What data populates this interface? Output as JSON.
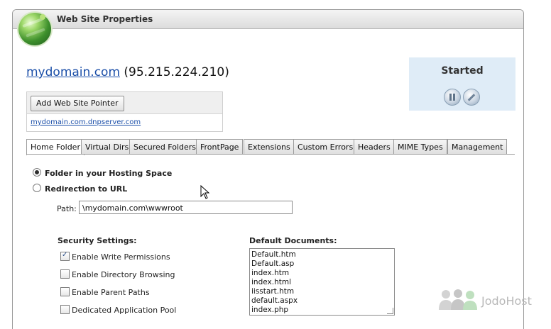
{
  "panel": {
    "title": "Web Site Properties"
  },
  "site": {
    "domain": "mydomain.com",
    "ip": "(95.215.224.210)",
    "add_pointer_label": "Add Web Site Pointer",
    "pointer_link": "mydomain.com.dnpserver.com"
  },
  "status": {
    "label": "Started",
    "controls": [
      "pause-icon",
      "stop-icon"
    ]
  },
  "tabs": [
    {
      "label": "Home Folder",
      "active": true
    },
    {
      "label": "Virtual Dirs"
    },
    {
      "label": "Secured Folders"
    },
    {
      "label": "FrontPage"
    },
    {
      "label": "Extensions"
    },
    {
      "label": "Custom Errors"
    },
    {
      "label": "Headers"
    },
    {
      "label": "MIME Types"
    },
    {
      "label": "Management"
    }
  ],
  "home_folder": {
    "options": [
      {
        "label": "Folder in your Hosting Space",
        "checked": true
      },
      {
        "label": "Redirection to URL",
        "checked": false
      }
    ],
    "path_label": "Path:",
    "path_value": "\\mydomain.com\\wwwroot"
  },
  "security": {
    "title": "Security Settings:",
    "items": [
      {
        "label": "Enable Write Permissions",
        "checked": true
      },
      {
        "label": "Enable Directory Browsing",
        "checked": false
      },
      {
        "label": "Enable Parent Paths",
        "checked": false
      },
      {
        "label": "Dedicated Application Pool",
        "checked": false
      }
    ]
  },
  "default_documents": {
    "title": "Default Documents:",
    "items": [
      "Default.htm",
      "Default.asp",
      "index.htm",
      "index.html",
      "iisstart.htm",
      "default.aspx",
      "index.php"
    ]
  },
  "watermark": {
    "text": "JodoHost"
  }
}
